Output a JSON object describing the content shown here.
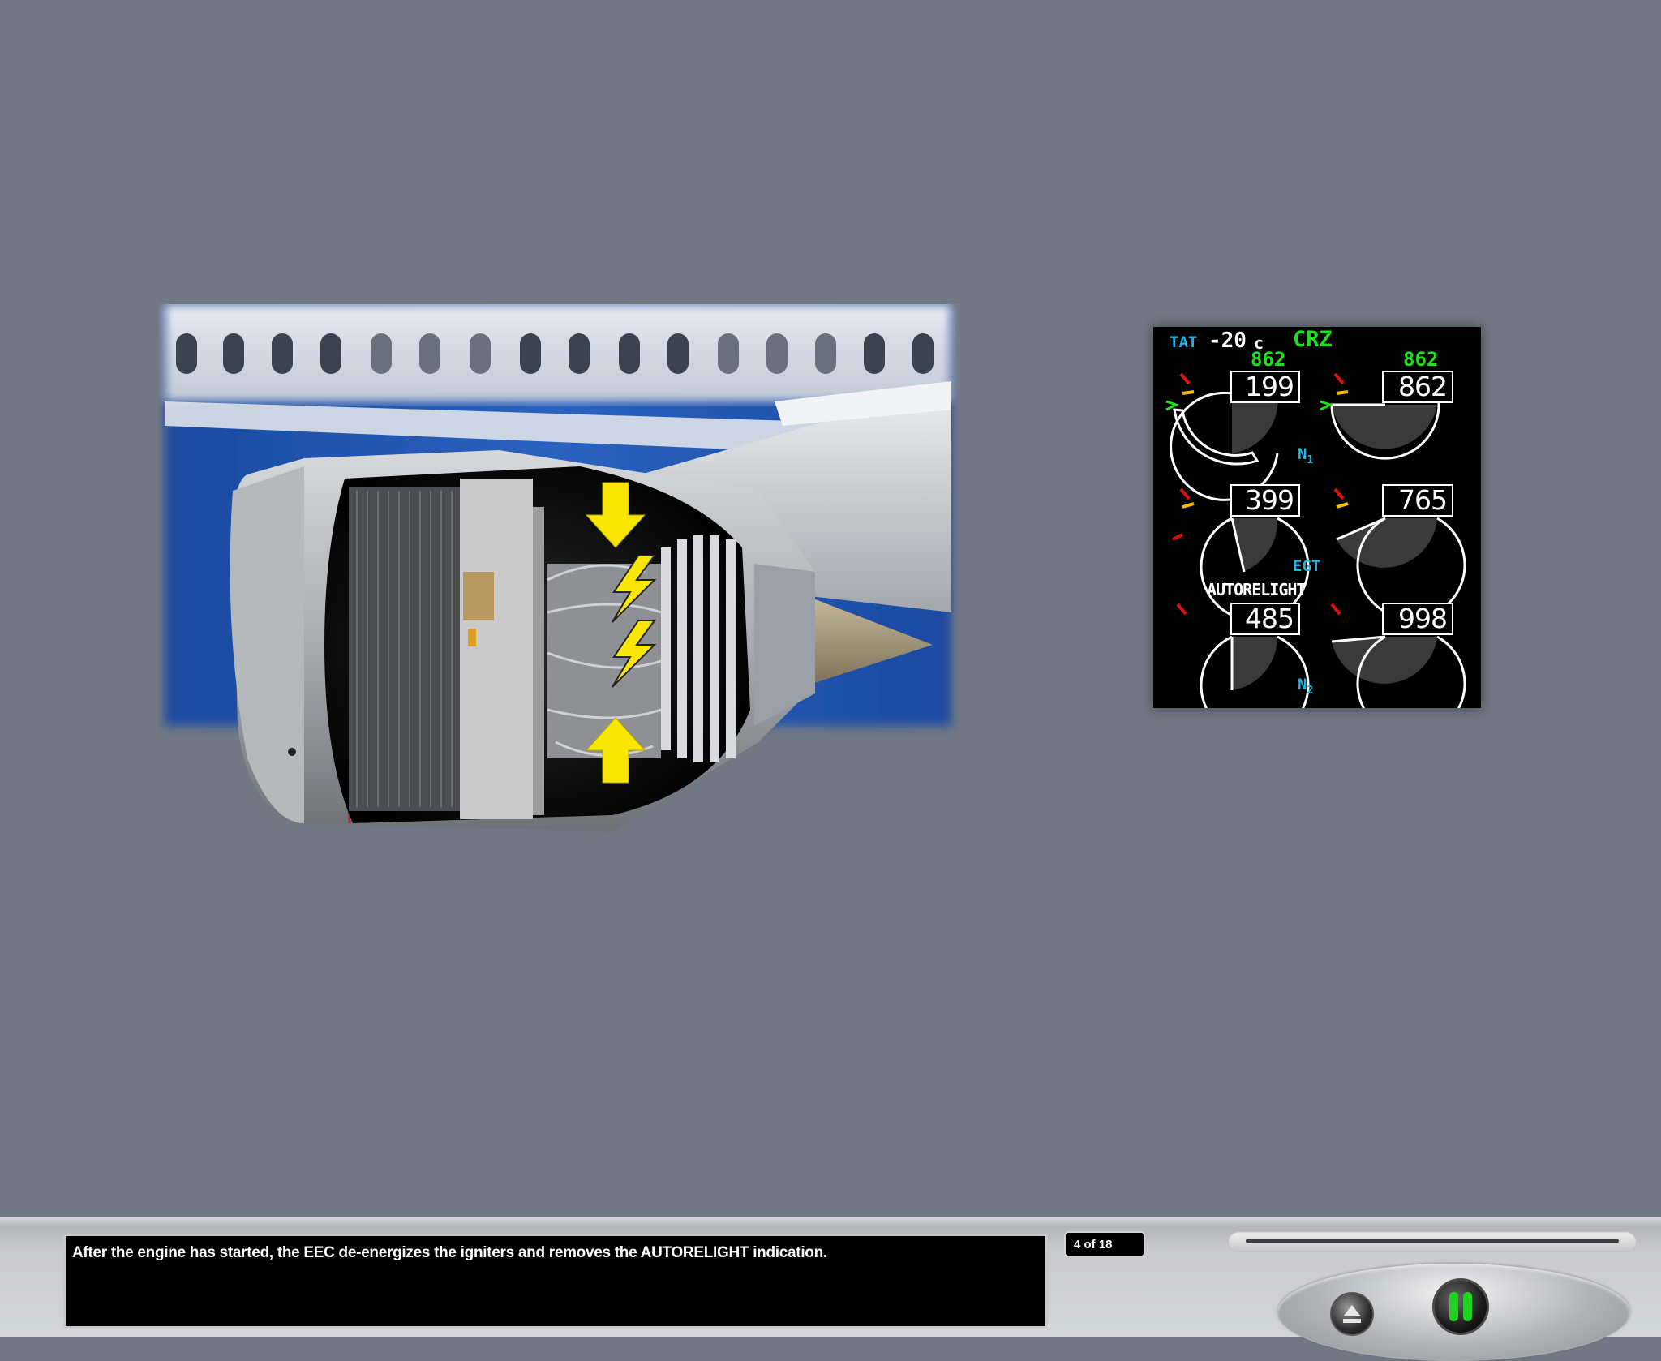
{
  "illustration": {
    "subject": "engine cutaway on wing with igniter arrows and lightning bolts",
    "colors": {
      "arrow": "#f7e600",
      "fuselage_band": "#1c4fa6"
    }
  },
  "eicas": {
    "tat_label": "TAT",
    "tat_value": "-20",
    "tat_unit": "c",
    "mode": "CRZ",
    "n1": {
      "left": {
        "target": "862",
        "value": "199"
      },
      "right": {
        "target": "862",
        "value": "862"
      },
      "label_main": "N",
      "label_sub": "1"
    },
    "egt": {
      "left": {
        "value": "399"
      },
      "right": {
        "value": "765"
      },
      "label": "EGT"
    },
    "autorelight": "AUTORELIGHT",
    "n2": {
      "left": {
        "value": "485"
      },
      "right": {
        "value": "998"
      },
      "label_main": "N",
      "label_sub": "2"
    },
    "colors": {
      "cyan": "#19b6e6",
      "green": "#1fe01f",
      "red": "#e01010",
      "amber": "#f0c000"
    }
  },
  "caption": "After the engine has started, the EEC de-energizes the igniters and removes the AUTORELIGHT indication.",
  "pagination": {
    "text": "4 of 18"
  },
  "controls": {
    "eject_icon": "eject-icon",
    "pause_icon": "pause-icon",
    "pause_color": "#1fd21f"
  }
}
